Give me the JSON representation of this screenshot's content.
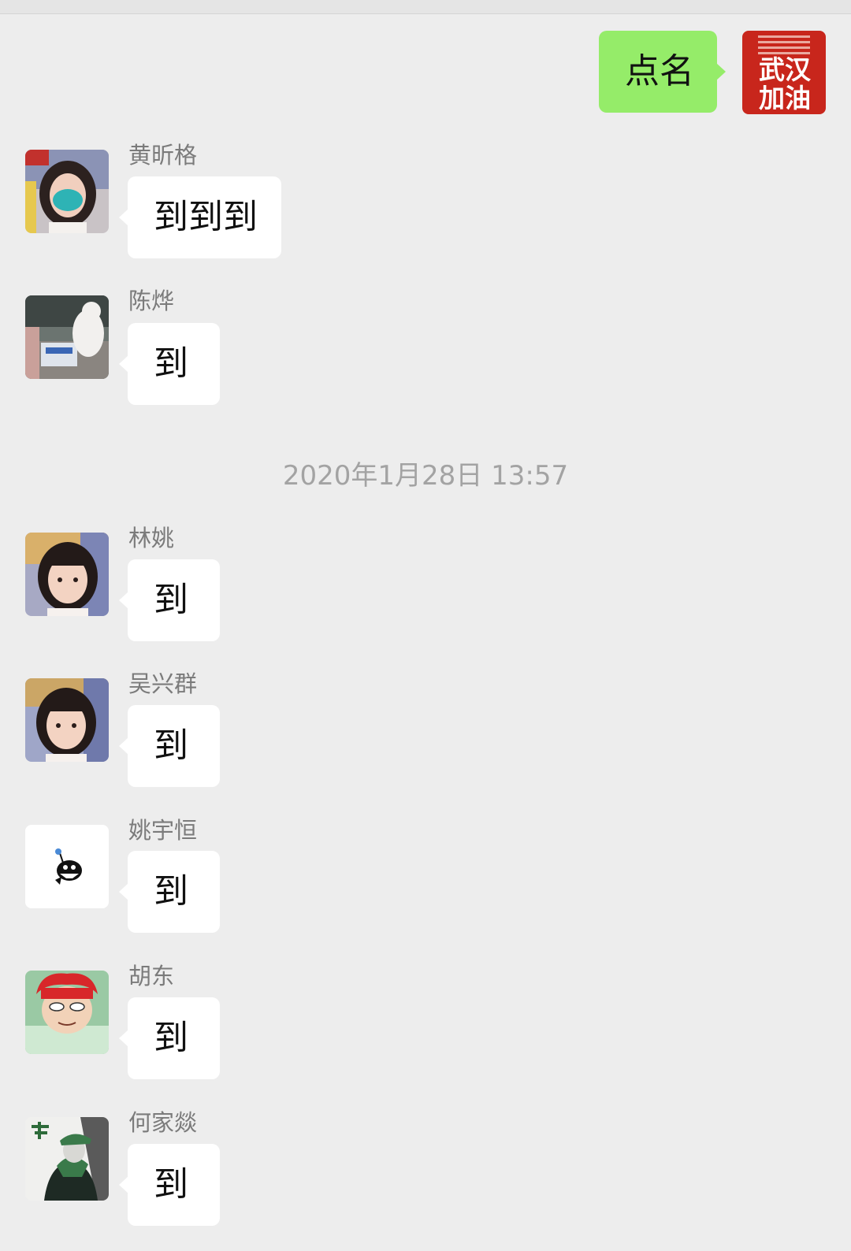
{
  "self": {
    "message": "点名",
    "avatar_text": "武汉加油",
    "bubble_color": "#95ec69"
  },
  "timestamp": "2020年1月28日 13:57",
  "messages": [
    {
      "name": "黄昕格",
      "text": "到到到"
    },
    {
      "name": "陈烨",
      "text": "到"
    },
    {
      "name": "林姚",
      "text": "到"
    },
    {
      "name": "吴兴群",
      "text": "到"
    },
    {
      "name": "姚宇恒",
      "text": "到"
    },
    {
      "name": "胡东",
      "text": "到"
    },
    {
      "name": "何家燚",
      "text": "到"
    }
  ],
  "colors": {
    "background": "#ededed",
    "incoming_bubble": "#ffffff",
    "name_text": "#7b7b7b",
    "timestamp_text": "#a3a3a3"
  }
}
